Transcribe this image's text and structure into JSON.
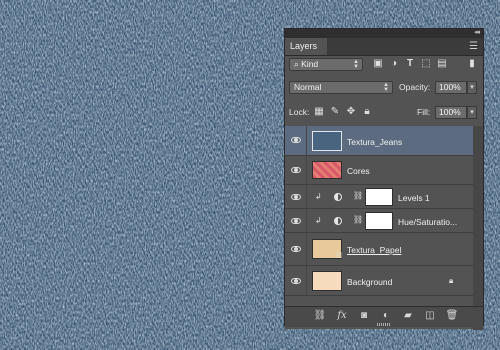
{
  "panel": {
    "tab_label": "Layers",
    "filter": {
      "kind_label": "Kind"
    },
    "blend_mode": "Normal",
    "opacity_label": "Opacity:",
    "opacity_value": "100%",
    "lock_label": "Lock:",
    "fill_label": "Fill:",
    "fill_value": "100%"
  },
  "layers": [
    {
      "name": "Textura_Jeans",
      "selected": true,
      "thumb": "denim"
    },
    {
      "name": "Cores",
      "selected": false,
      "thumb": "pink-gradient"
    },
    {
      "name": "Levels 1",
      "selected": false,
      "thumb": "adjustment-levels"
    },
    {
      "name": "Hue/Saturatio...",
      "selected": false,
      "thumb": "adjustment-hue"
    },
    {
      "name": "Textura_Papel",
      "selected": false,
      "thumb": "paper"
    },
    {
      "name": "Background",
      "selected": false,
      "thumb": "peach",
      "locked": true
    }
  ],
  "colors": {
    "panel_bg": "#535353",
    "selected_row": "#5d6b80",
    "denim": "#3c5672"
  }
}
